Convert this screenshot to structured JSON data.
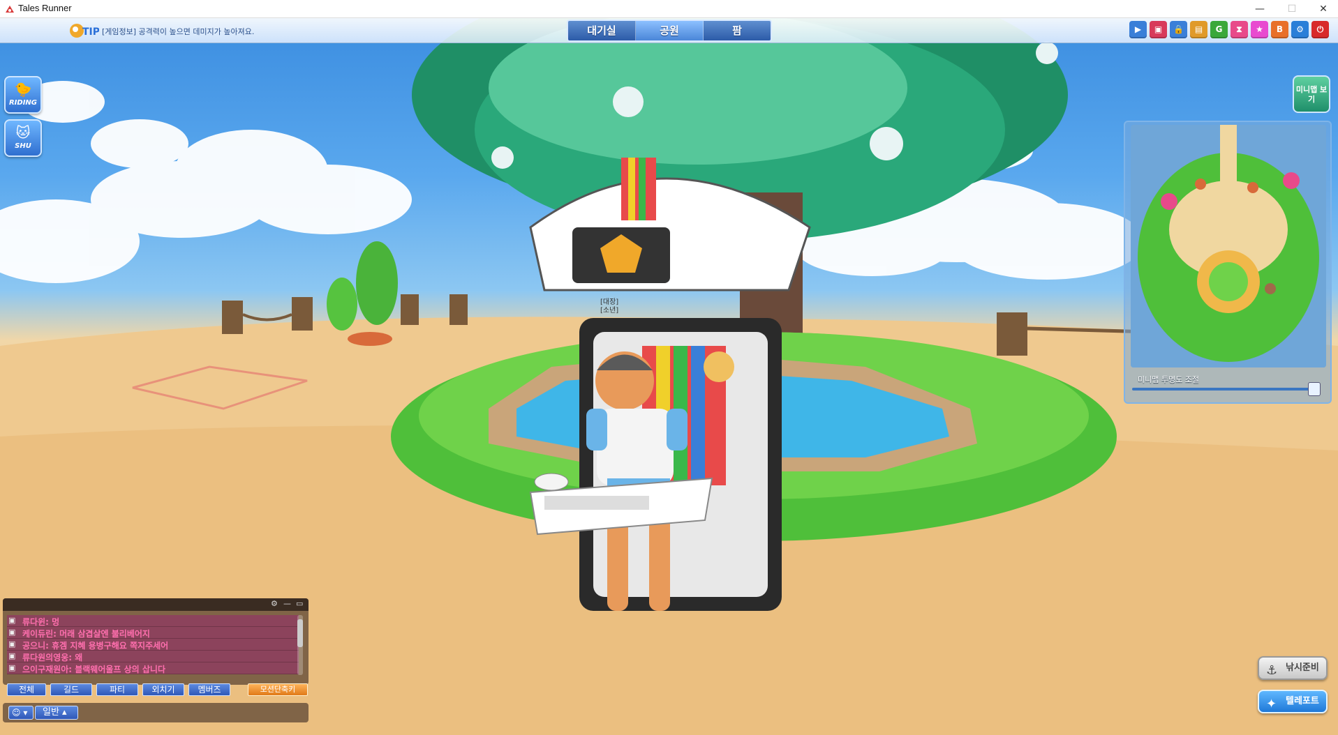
{
  "window": {
    "title": "Tales Runner",
    "minimize": "—",
    "maximize": "☐",
    "close": "✕"
  },
  "hud": {
    "tip_text": "[게임정보] 공격력이 높으면 데미지가 높아져요.",
    "tabs": [
      {
        "label": "대기실",
        "active": false
      },
      {
        "label": "공원",
        "active": true
      },
      {
        "label": "팜",
        "active": false
      }
    ],
    "top_icons": [
      {
        "name": "arrow-icon",
        "glyph": "▶",
        "color": "#3a7fd8"
      },
      {
        "name": "shop-icon",
        "glyph": "▣",
        "color": "#d83a5a"
      },
      {
        "name": "lock-icon",
        "glyph": "🔒",
        "color": "#3a7fd8"
      },
      {
        "name": "bag-icon",
        "glyph": "▤",
        "color": "#e09a2a"
      },
      {
        "name": "g-icon",
        "glyph": "G",
        "color": "#3aa83a"
      },
      {
        "name": "hourglass-icon",
        "glyph": "⧗",
        "color": "#e84a8a"
      },
      {
        "name": "star-icon",
        "glyph": "★",
        "color": "#e84ad0"
      },
      {
        "name": "book-icon",
        "glyph": "B",
        "color": "#e8702a"
      },
      {
        "name": "gear-icon",
        "glyph": "⚙",
        "color": "#2a7fd8"
      },
      {
        "name": "power-icon",
        "glyph": "⏻",
        "color": "#d82a2a"
      }
    ]
  },
  "side": {
    "riding_label": "RIDING",
    "shu_label": "SHU"
  },
  "minimap": {
    "toggle_label": "미니맵 보기",
    "opacity_label": "미니맵 투명도 조절",
    "opacity_value": 1.0
  },
  "player": {
    "name_line1": "[대장]",
    "name_line2": "[소년]"
  },
  "chat": {
    "messages": [
      "류다윈: 멍",
      "케이듀린: 머래 삼겹살엔 불리베어지",
      "공으니: 휴겜 지혜 용병구해요 쪽지주세어",
      "류다원의영웅: 왜",
      "으이구재원아: 블랙웨어울프 상의 삽니다"
    ],
    "tabs": [
      "전체",
      "길드",
      "파티",
      "외치기",
      "멤버즈"
    ],
    "ignore_button": "모션단축키",
    "emoji_button": "☺",
    "mode_button": "일반"
  },
  "actions": {
    "fishing": "낚시준비",
    "teleport": "텔레포트"
  }
}
